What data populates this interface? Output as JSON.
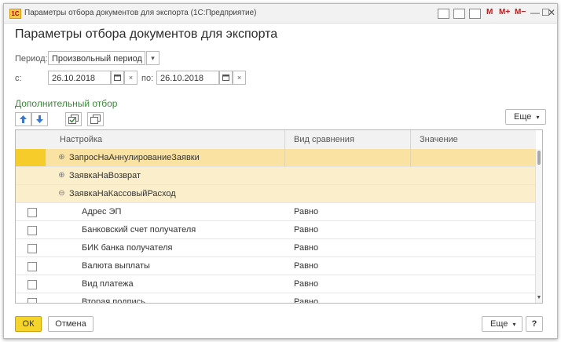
{
  "window": {
    "title": "Параметры отбора документов для экспорта  (1С:Предприятие)",
    "logo_text": "1С",
    "m_buttons": [
      "M",
      "M+",
      "M−"
    ],
    "minimize": "—",
    "maximize": "☐",
    "close": "✕"
  },
  "form": {
    "title": "Параметры отбора документов для экспорта",
    "period_label": "Период:",
    "period_value": "Произвольный период",
    "from_label": "с:",
    "from_date": "26.10.2018",
    "to_label": "по:",
    "to_date": "26.10.2018",
    "clear_symbol": "×",
    "dropdown_symbol": "▾"
  },
  "filter": {
    "section_title": "Дополнительный отбор",
    "more_label": "Еще",
    "columns": [
      "Настройка",
      "Вид сравнения",
      "Значение"
    ],
    "groups": [
      {
        "name": "ЗапросНаАннулированиеЗаявки",
        "expander": "⊕"
      },
      {
        "name": "ЗаявкаНаВозврат",
        "expander": "⊕"
      },
      {
        "name": "ЗаявкаНаКассовыйРасход",
        "expander": "⊖"
      }
    ],
    "rows": [
      {
        "name": "Адрес ЭП",
        "comparison": "Равно"
      },
      {
        "name": "Банковский счет получателя",
        "comparison": "Равно"
      },
      {
        "name": "БИК банка получателя",
        "comparison": "Равно"
      },
      {
        "name": "Валюта выплаты",
        "comparison": "Равно"
      },
      {
        "name": "Вид платежа",
        "comparison": "Равно"
      },
      {
        "name": "Вторая подпись",
        "comparison": "Равно"
      }
    ]
  },
  "footer": {
    "ok_label": "ОК",
    "cancel_label": "Отмена",
    "more_label": "Еще",
    "help_label": "?"
  },
  "colors": {
    "accent_yellow": "#f6d52a",
    "section_green": "#3a8a3a",
    "group_row": "#faeecb"
  }
}
